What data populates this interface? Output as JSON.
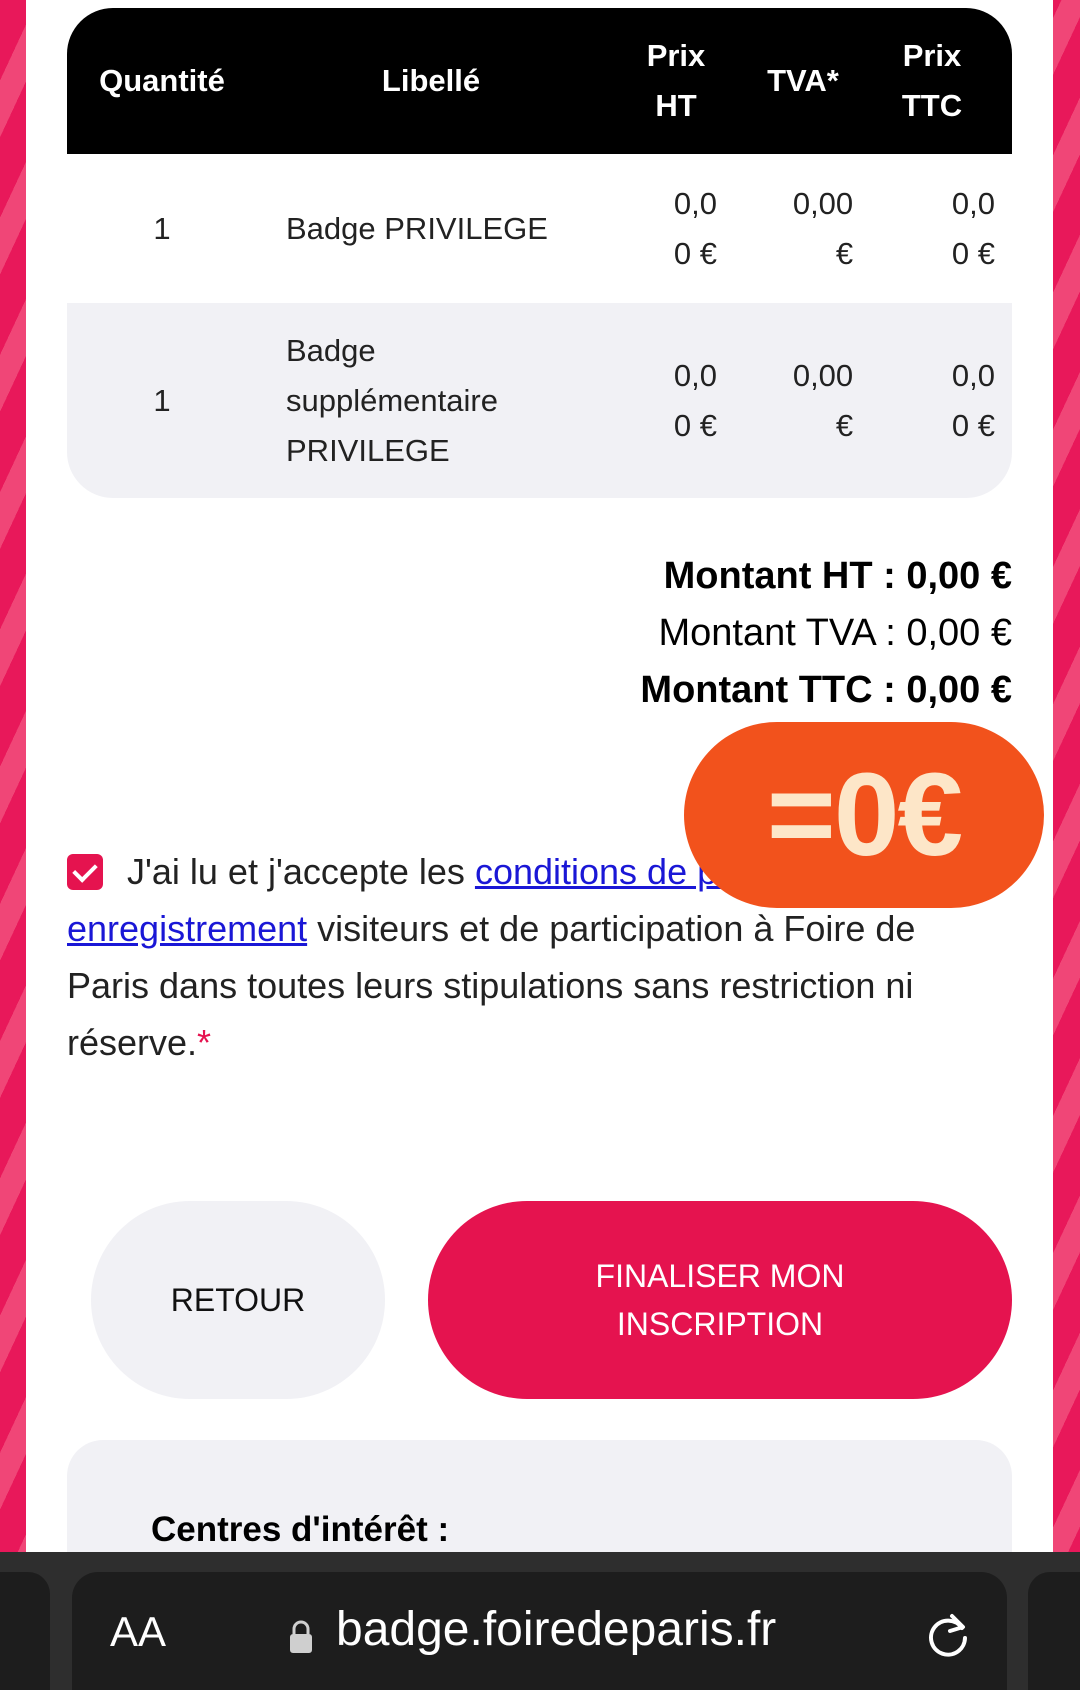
{
  "table": {
    "headers": {
      "quantite": "Quantité",
      "libelle": "Libellé",
      "prix_ht": [
        "Prix",
        "HT"
      ],
      "tva": "TVA*",
      "prix_ttc": [
        "Prix",
        "TTC"
      ]
    },
    "rows": [
      {
        "quantite": "1",
        "libelle": [
          "Badge PRIVILEGE"
        ],
        "prix_ht": [
          "0,0",
          "0 €"
        ],
        "tva": [
          "0,00",
          "€"
        ],
        "prix_ttc": [
          "0,0",
          "0 €"
        ]
      },
      {
        "quantite": "1",
        "libelle": [
          "Badge",
          "supplémentaire",
          "PRIVILEGE"
        ],
        "prix_ht": [
          "0,0",
          "0 €"
        ],
        "tva": [
          "0,00",
          "€"
        ],
        "prix_ttc": [
          "0,0",
          "0 €"
        ]
      }
    ]
  },
  "totals": {
    "montant_ht": "Montant HT : 0,00 €",
    "montant_tva": "Montant TVA : 0,00 €",
    "montant_ttc": "Montant TTC : 0,00 €"
  },
  "overlay_sticker": "=0€",
  "terms": {
    "checked": true,
    "text_before": "J'ai lu et j'accepte les ",
    "link_text": "conditions de pré-enregistrement",
    "text_after": " visiteurs et de participation à Foire de Paris dans toutes leurs stipulations sans restriction ni réserve.",
    "required_mark": "*"
  },
  "buttons": {
    "back": "RETOUR",
    "finalize": [
      "FINALISER MON",
      "INSCRIPTION"
    ]
  },
  "interests": {
    "title": "Centres d'intérêt :"
  },
  "browser": {
    "text_size_label": "AA",
    "url": "badge.foiredeparis.fr"
  },
  "colors": {
    "accent": "#e5134f",
    "sticker": "#f2521c",
    "header_bg": "#000000",
    "link": "#1a17d6"
  }
}
